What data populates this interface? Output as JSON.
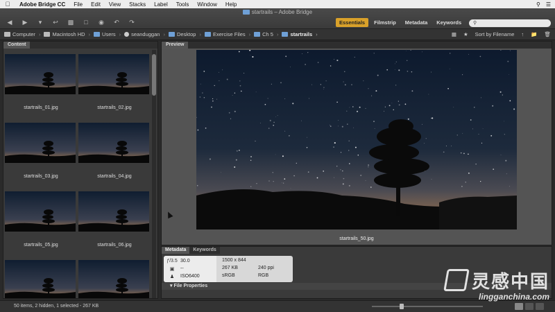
{
  "menubar": {
    "app": "Adobe Bridge CC",
    "items": [
      "File",
      "Edit",
      "View",
      "Stacks",
      "Label",
      "Tools",
      "Window",
      "Help"
    ]
  },
  "window": {
    "title": "startrails – Adobe Bridge"
  },
  "workspaces": {
    "items": [
      "Essentials",
      "Filmstrip",
      "Metadata",
      "Keywords"
    ],
    "active": "Essentials"
  },
  "search": {
    "placeholder": ""
  },
  "path": [
    "Computer",
    "Macintosh HD",
    "Users",
    "seanduggan",
    "Desktop",
    "Exercise Files",
    "Ch 5",
    "startrails"
  ],
  "sort": {
    "label": "Sort by Filename"
  },
  "content_panel": {
    "label": "Content"
  },
  "thumbnails": [
    "startrails_01.jpg",
    "startrails_02.jpg",
    "startrails_03.jpg",
    "startrails_04.jpg",
    "startrails_05.jpg",
    "startrails_06.jpg",
    "",
    ""
  ],
  "preview_panel": {
    "label": "Preview",
    "caption": "startrails_50.jpg"
  },
  "metadata_panel": {
    "tabs": [
      "Metadata",
      "Keywords"
    ],
    "aperture": "ƒ/3.5",
    "shutter": "30.0",
    "metering": "--",
    "iso": "6400",
    "dimensions": "1500 x 844",
    "file_size": "267 KB",
    "resolution": "240 ppi",
    "color_space": "sRGB",
    "color_mode": "RGB",
    "section": "File Properties"
  },
  "status": {
    "text": "50 items, 2 hidden, 1 selected - 267 KB"
  },
  "watermark": {
    "cn": "灵感中国",
    "url": "lingganchina.com"
  }
}
